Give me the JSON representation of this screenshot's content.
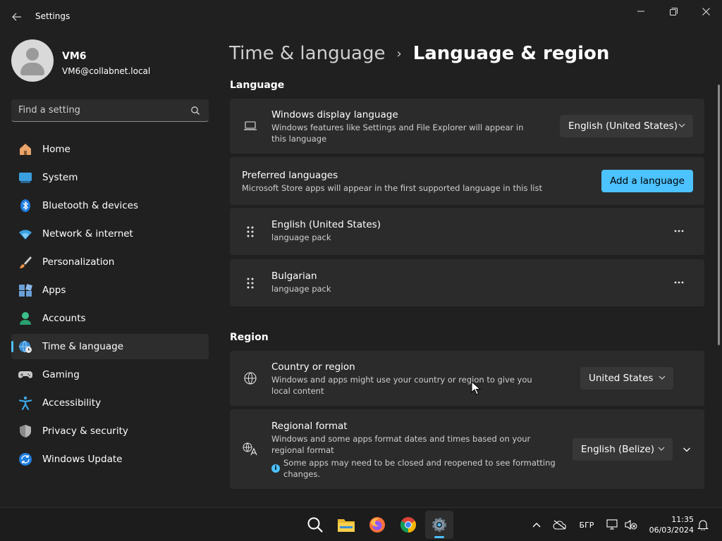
{
  "window": {
    "title": "Settings",
    "back_icon": "arrow-left-icon",
    "controls": [
      "minimize-icon",
      "maximize-icon",
      "close-icon"
    ]
  },
  "profile": {
    "name": "VM6",
    "email": "VM6@collabnet.local"
  },
  "search": {
    "placeholder": "Find a setting"
  },
  "sidebar": {
    "items": [
      {
        "label": "Home",
        "icon": "home-icon",
        "active": false
      },
      {
        "label": "System",
        "icon": "monitor-icon",
        "active": false
      },
      {
        "label": "Bluetooth & devices",
        "icon": "bluetooth-icon",
        "active": false
      },
      {
        "label": "Network & internet",
        "icon": "wifi-icon",
        "active": false
      },
      {
        "label": "Personalization",
        "icon": "brush-icon",
        "active": false
      },
      {
        "label": "Apps",
        "icon": "apps-icon",
        "active": false
      },
      {
        "label": "Accounts",
        "icon": "person-icon",
        "active": false
      },
      {
        "label": "Time & language",
        "icon": "globe-clock-icon",
        "active": true
      },
      {
        "label": "Gaming",
        "icon": "gamepad-icon",
        "active": false
      },
      {
        "label": "Accessibility",
        "icon": "accessibility-icon",
        "active": false
      },
      {
        "label": "Privacy & security",
        "icon": "shield-icon",
        "active": false
      },
      {
        "label": "Windows Update",
        "icon": "update-icon",
        "active": false
      }
    ]
  },
  "breadcrumb": {
    "parent": "Time & language",
    "separator": "›",
    "current": "Language & region"
  },
  "language": {
    "section_title": "Language",
    "display_language": {
      "title": "Windows display language",
      "subtitle": "Windows features like Settings and File Explorer will appear in this language",
      "value": "English (United States)"
    },
    "preferred": {
      "title": "Preferred languages",
      "subtitle": "Microsoft Store apps will appear in the first supported language in this list",
      "add_button": "Add a language"
    },
    "languages": [
      {
        "name": "English (United States)",
        "detail": "language pack"
      },
      {
        "name": "Bulgarian",
        "detail": "language pack"
      }
    ]
  },
  "region": {
    "section_title": "Region",
    "country": {
      "title": "Country or region",
      "subtitle": "Windows and apps might use your country or region to give you local content",
      "value": "United States"
    },
    "format": {
      "title": "Regional format",
      "subtitle": "Windows and some apps format dates and times based on your regional format",
      "info": "Some apps may need to be closed and reopened to see formatting changes.",
      "value": "English (Belize)"
    }
  },
  "taskbar": {
    "apps": [
      "search-icon",
      "file-explorer-icon",
      "firefox-icon",
      "chrome-icon",
      "settings-icon"
    ],
    "input_language": "БГР",
    "time": "11:35",
    "date": "06/03/2024"
  },
  "colors": {
    "accent": "#4cc2ff",
    "background": "#202020",
    "card": "#2b2b2b"
  }
}
